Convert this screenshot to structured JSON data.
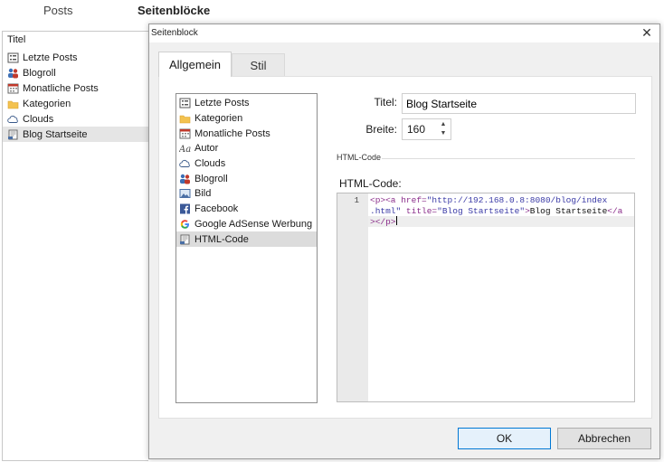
{
  "app": {
    "tabs": [
      {
        "label": "Posts"
      },
      {
        "label": "Seitenblöcke"
      }
    ],
    "left_panel": {
      "header": "Titel",
      "items": [
        {
          "label": "Letzte Posts",
          "icon": "list-icon"
        },
        {
          "label": "Blogroll",
          "icon": "people-icon"
        },
        {
          "label": "Monatliche Posts",
          "icon": "calendar-icon"
        },
        {
          "label": "Kategorien",
          "icon": "folder-icon"
        },
        {
          "label": "Clouds",
          "icon": "cloud-icon"
        },
        {
          "label": "Blog Startseite",
          "icon": "html-code-icon",
          "selected": true
        }
      ]
    }
  },
  "dialog": {
    "title": "Seitenblock",
    "close_label": "✕",
    "tabs": [
      {
        "label": "Allgemein",
        "active": true
      },
      {
        "label": "Stil",
        "active": false
      }
    ],
    "block_types": [
      {
        "label": "Letzte Posts",
        "icon": "list-icon"
      },
      {
        "label": "Kategorien",
        "icon": "folder-icon"
      },
      {
        "label": "Monatliche Posts",
        "icon": "calendar-icon"
      },
      {
        "label": "Autor",
        "icon": "font-icon"
      },
      {
        "label": "Clouds",
        "icon": "cloud-icon"
      },
      {
        "label": "Blogroll",
        "icon": "people-icon"
      },
      {
        "label": "Bild",
        "icon": "image-icon"
      },
      {
        "label": "Facebook",
        "icon": "facebook-icon"
      },
      {
        "label": "Google AdSense Werbung",
        "icon": "google-icon"
      },
      {
        "label": "HTML-Code",
        "icon": "html-code-icon",
        "selected": true
      }
    ],
    "title_label": "Titel:",
    "title_value": "Blog Startseite",
    "width_label": "Breite:",
    "width_value": "160",
    "group_label": "HTML-Code",
    "html_label": "HTML-Code:",
    "code": {
      "line_number": "1",
      "lines": [
        "<p><a href=\"http://192.168.0.8:8080/blog/index",
        ".html\" title=\"Blog Startseite\">Blog Startseite</a",
        "></p>"
      ]
    },
    "ok_label": "OK",
    "cancel_label": "Abbrechen"
  },
  "colors": {
    "accent": "#0078d4",
    "dialog_bg": "#f0f0f0",
    "selection": "#dcdcdc"
  }
}
